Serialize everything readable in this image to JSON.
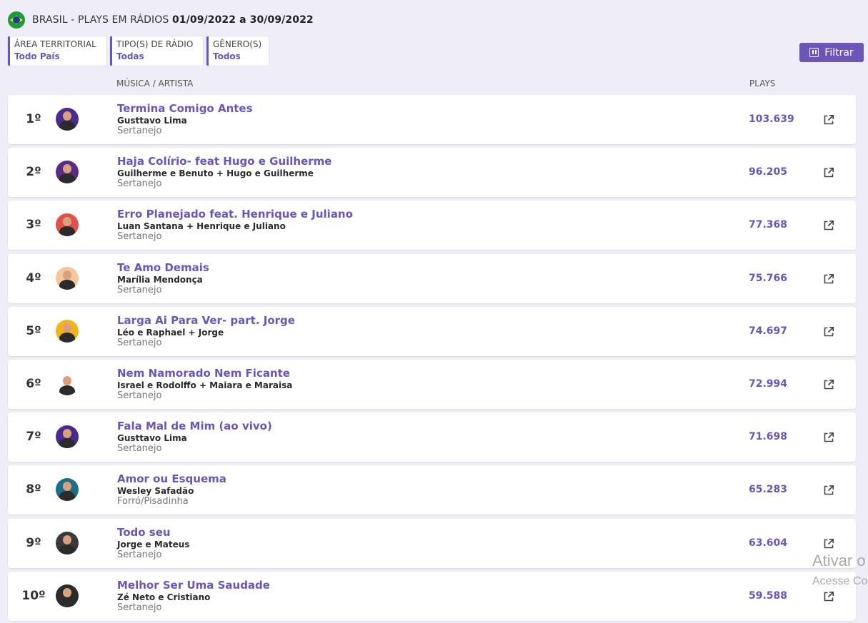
{
  "header": {
    "title": "BRASIL - PLAYS EM RÁDIOS",
    "date_range": "01/09/2022 a 30/09/2022",
    "flag_icon": "brazil-flag-icon"
  },
  "filters": [
    {
      "label": "ÁREA TERRITORIAL",
      "value": "Todo País"
    },
    {
      "label": "TIPO(S) DE RÁDIO",
      "value": "Todas"
    },
    {
      "label": "GÊNERO(S)",
      "value": "Todos"
    }
  ],
  "filter_button": {
    "label": "Filtrar",
    "icon": "filter-sliders-icon"
  },
  "columns": {
    "music": "MÚSICA / ARTISTA",
    "plays": "PLAYS"
  },
  "accent_color": "#6b55b8",
  "rows": [
    {
      "rank": "1º",
      "song": "Termina Comigo Antes",
      "artist": "Gusttavo Lima",
      "genre": "Sertanejo",
      "plays": "103.639"
    },
    {
      "rank": "2º",
      "song": "Haja Colírio- feat Hugo e Guilherme",
      "artist": "Guilherme e Benuto + Hugo e Guilherme",
      "genre": "Sertanejo",
      "plays": "96.205"
    },
    {
      "rank": "3º",
      "song": "Erro Planejado feat. Henrique e Juliano",
      "artist": "Luan Santana + Henrique e Juliano",
      "genre": "Sertanejo",
      "plays": "77.368"
    },
    {
      "rank": "4º",
      "song": "Te Amo Demais",
      "artist": "Marília Mendonça",
      "genre": "Sertanejo",
      "plays": "75.766"
    },
    {
      "rank": "5º",
      "song": "Larga Ai Para Ver- part. Jorge",
      "artist": "Léo e Raphael + Jorge",
      "genre": "Sertanejo",
      "plays": "74.697"
    },
    {
      "rank": "6º",
      "song": "Nem Namorado Nem Ficante",
      "artist": "Israel e Rodolffo + Maiara e Maraisa",
      "genre": "Sertanejo",
      "plays": "72.994"
    },
    {
      "rank": "7º",
      "song": "Fala Mal de Mim (ao vivo)",
      "artist": "Gusttavo Lima",
      "genre": "Sertanejo",
      "plays": "71.698"
    },
    {
      "rank": "8º",
      "song": "Amor ou Esquema",
      "artist": "Wesley Safadão",
      "genre": "Forró/Pisadinha",
      "plays": "65.283"
    },
    {
      "rank": "9º",
      "song": "Todo seu",
      "artist": "Jorge e Mateus",
      "genre": "Sertanejo",
      "plays": "63.604"
    },
    {
      "rank": "10º",
      "song": "Melhor Ser Uma Saudade",
      "artist": "Zé Neto e Cristiano",
      "genre": "Sertanejo",
      "plays": "59.588"
    }
  ],
  "avatar_colors": [
    "#4a2b8f",
    "#5a2a86",
    "#e2504a",
    "#f3c79a",
    "#f0b41c",
    "#ffffff",
    "#4a2b8f",
    "#1d6e8a",
    "#3a3a3a",
    "#2b2b2b"
  ],
  "watermark": {
    "line1": "Ativar o",
    "line2": "Acesse Co"
  }
}
